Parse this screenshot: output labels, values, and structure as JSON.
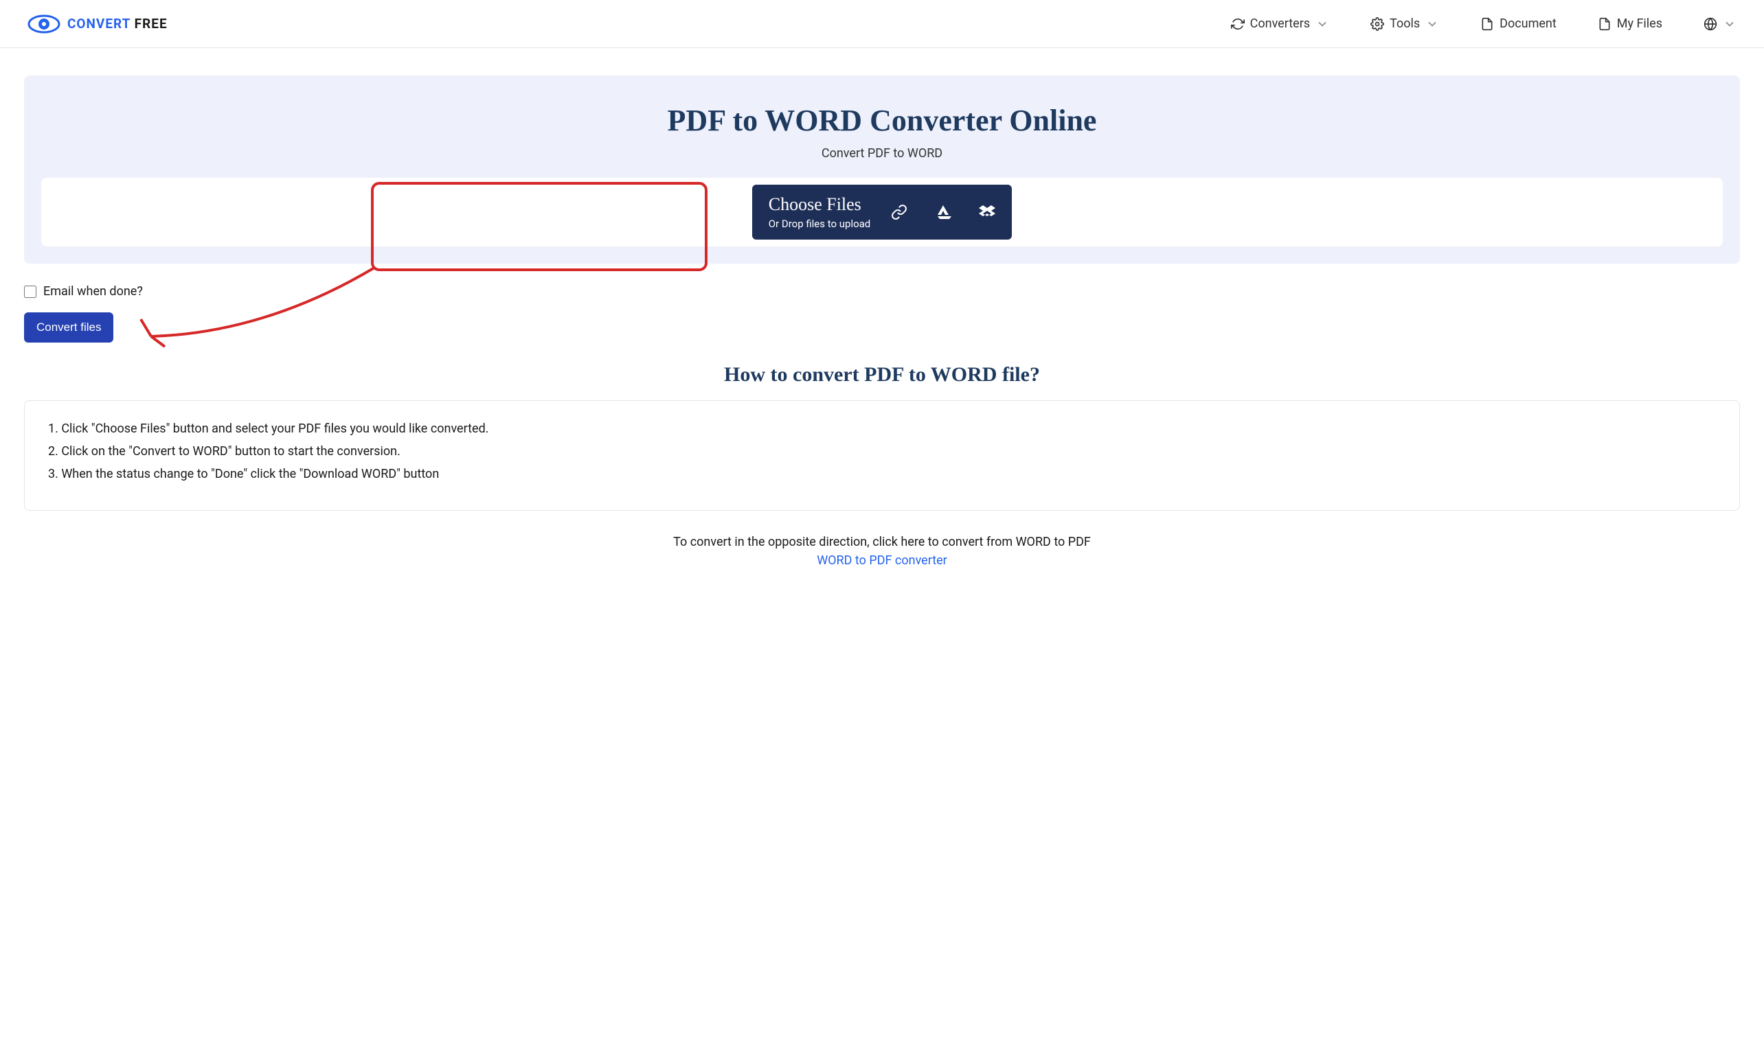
{
  "logo": {
    "convert": "CONVERT",
    "free": " FREE"
  },
  "nav": {
    "converters": "Converters",
    "tools": "Tools",
    "document": "Document",
    "myfiles": "My Files"
  },
  "hero": {
    "title": "PDF to WORD Converter Online",
    "subtitle": "Convert PDF to WORD"
  },
  "choose": {
    "title": "Choose Files",
    "sub": "Or Drop files to upload"
  },
  "email_label": "Email when done?",
  "convert_button": "Convert files",
  "howto_title": "How to convert PDF to WORD file?",
  "steps": [
    "Click \"Choose Files\" button and select your PDF files you would like converted.",
    "Click on the \"Convert to WORD\" button to start the conversion.",
    "When the status change to \"Done\" click the \"Download WORD\" button"
  ],
  "opposite": {
    "text": "To convert in the opposite direction, click here to convert from WORD to PDF",
    "link": "WORD to PDF converter"
  }
}
